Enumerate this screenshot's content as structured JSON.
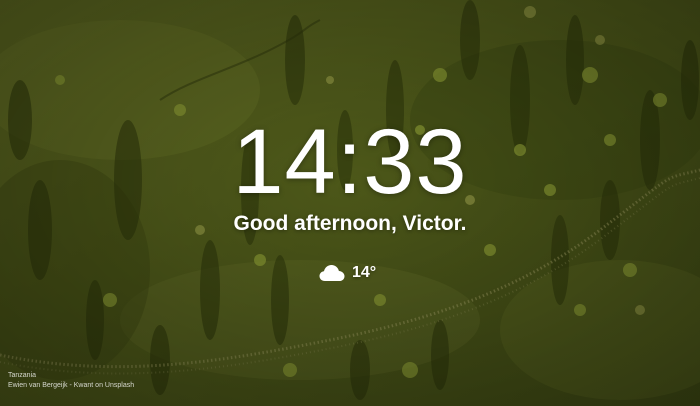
{
  "clock": {
    "time": "14:33"
  },
  "greeting": {
    "text": "Good afternoon, Victor."
  },
  "weather": {
    "icon": "cloud-icon",
    "temperature": "14°"
  },
  "photo_credit": {
    "location": "Tanzania",
    "photographer": "Ewien van Bergeijk - Kwant",
    "connector": "on",
    "source": "Unsplash"
  },
  "colors": {
    "background_base": "#4f5a1c",
    "text": "#ffffff"
  }
}
